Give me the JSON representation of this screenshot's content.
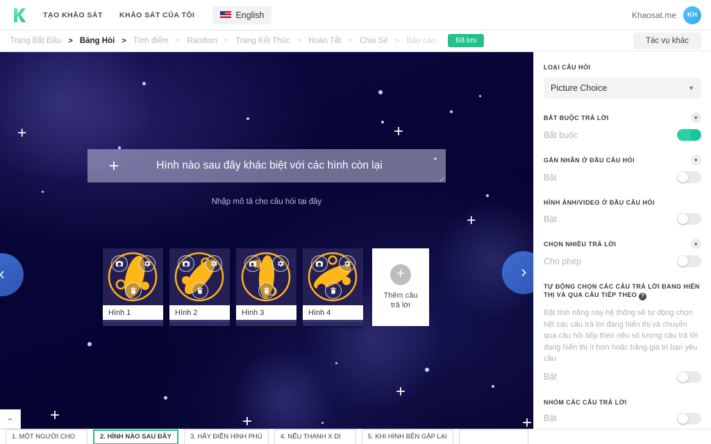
{
  "header": {
    "logo_icon": "kh-logo-icon",
    "nav": [
      {
        "label": "TẠO KHẢO SÁT"
      },
      {
        "label": "KHẢO SÁT CỦA TÔI"
      }
    ],
    "language": {
      "label": "English",
      "flag_icon": "us-flag-icon"
    },
    "account_name": "Khaosat.me",
    "avatar_initials": "KH"
  },
  "breadcrumb": {
    "items": [
      {
        "label": "Trang Bắt Đầu",
        "state": "normal"
      },
      {
        "label": "Bảng Hỏi",
        "state": "active"
      },
      {
        "label": "Tính điểm",
        "state": "normal"
      },
      {
        "label": "Random",
        "state": "normal"
      },
      {
        "label": "Trang Kết Thúc",
        "state": "normal"
      },
      {
        "label": "Hoàn Tất",
        "state": "normal"
      },
      {
        "label": "Chia Sẻ",
        "state": "normal"
      },
      {
        "label": "Báo cáo",
        "state": "dim"
      }
    ],
    "separator": ">",
    "saved_badge": "Đã lưu",
    "other_actions": "Tác vụ khác"
  },
  "canvas": {
    "question": {
      "add_icon": "plus-icon",
      "title": "Hình nào sau đây khác biệt với các hình còn lại",
      "description_placeholder": "Nhập mô tả cho câu hỏi tại đây"
    },
    "answers": [
      {
        "label": "Hình 1"
      },
      {
        "label": "Hình 2"
      },
      {
        "label": "Hình 3"
      },
      {
        "label": "Hình 4"
      }
    ],
    "answer_icons": {
      "camera": "camera-icon",
      "settings": "gear-icon",
      "delete": "trash-icon"
    },
    "add_answer": {
      "icon": "plus-circle-icon",
      "label": "Thêm câu trả lời"
    },
    "nav_prev_icon": "chevron-left-icon",
    "nav_next_icon": "chevron-right-icon"
  },
  "panel": {
    "question_type": {
      "label": "LOẠI CÂU HỎI",
      "value": "Picture Choice",
      "caret_icon": "chevron-down-icon"
    },
    "settings": [
      {
        "label": "BẮT BUỘC TRẢ LỜI",
        "bolt_icon": "bolt-icon",
        "has_bolt": true,
        "toggle_label": "Bắt buộc",
        "toggle_on": true
      },
      {
        "label": "GẮN NHÃN Ở ĐẦU CÂU HỎI",
        "bolt_icon": "bolt-icon",
        "has_bolt": true,
        "toggle_label": "Bật",
        "toggle_on": false
      },
      {
        "label": "HÌNH ẢNH/VIDEO Ở ĐẦU CÂU HỎI",
        "has_bolt": false,
        "toggle_label": "Bật",
        "toggle_on": false
      },
      {
        "label": "CHỌN NHIỀU TRẢ LỜI",
        "bolt_icon": "bolt-icon",
        "has_bolt": true,
        "toggle_label": "Cho phép",
        "toggle_on": false
      }
    ],
    "auto_select": {
      "label": "TỰ ĐỘNG CHỌN CÁC CÂU TRẢ LỜI ĐANG HIỂN THỊ VÀ QUA CÂU TIẾP THEO",
      "help_icon": "question-mark-icon",
      "help_char": "?",
      "description": "Bật tính năng này hệ thống sẽ tự động chọn hết các câu trả lời đang hiển thị và chuyển qua câu hỏi tiếp theo nếu số lượng câu trả lời đang hiển thị ít hơn hoặc bằng giá trị bạn yêu cầu",
      "toggle_label": "Bật",
      "toggle_on": false
    },
    "group_answers": {
      "label": "NHÓM CÁC CÂU TRẢ LỜI",
      "toggle_label": "Bật",
      "toggle_on": false
    }
  },
  "bottom": {
    "collapse_icon": "chevron-up-icon",
    "questions": [
      {
        "label": "1. MỘT NGƯỜI CHO",
        "selected": false
      },
      {
        "label": "2. HÌNH NÀO SAU ĐÂY",
        "selected": true
      },
      {
        "label": "3. HÃY ĐIỀN HÌNH PHÙ",
        "selected": false
      },
      {
        "label": "4. NẾU THANH X DI",
        "selected": false
      },
      {
        "label": "5. KHI HÌNH BÊN GẶP LẠI",
        "selected": false
      },
      {
        "label": "",
        "selected": false
      }
    ]
  },
  "colors": {
    "accent_green": "#25c08a",
    "toggle_on": "#2ecfa3",
    "nav_blue": "#3f6ed0",
    "canvas_dark": "#070536",
    "tile_orange": "#ffb619"
  }
}
